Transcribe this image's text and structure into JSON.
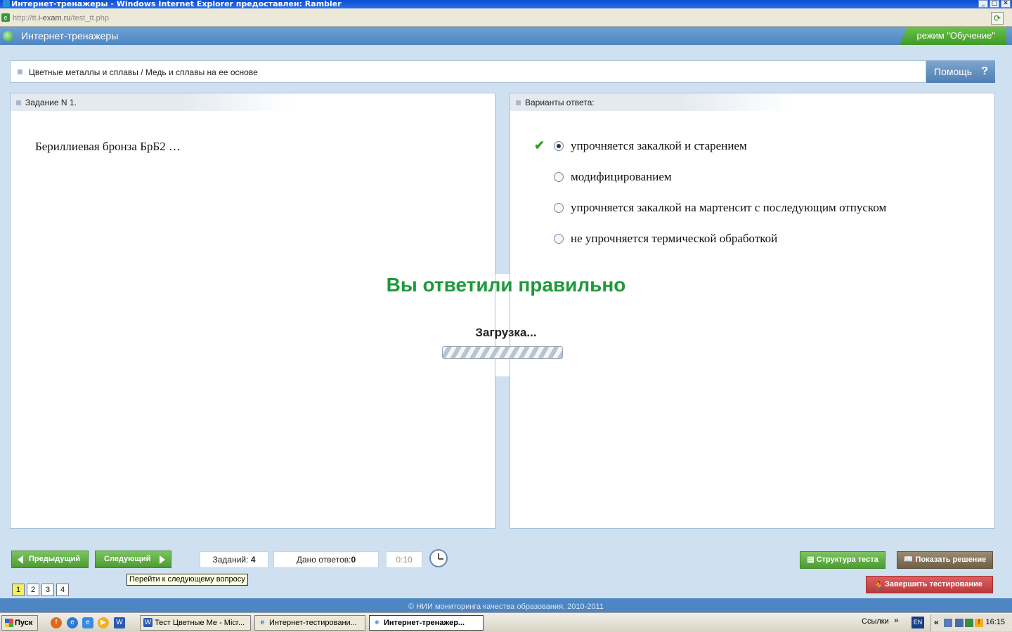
{
  "window": {
    "title": "Интернет-тренажеры - Windows Internet Explorer предоставлен: Rambler",
    "url_prefix": "http://tt.",
    "url_domain": "i-exam.ru",
    "url_path": "/test_tt.php"
  },
  "header": {
    "app_title": "Интернет-тренажеры",
    "mode": "режим \"Обучение\""
  },
  "breadcrumb": {
    "text": "Цветные металлы и сплавы / Медь и сплавы на ее основе",
    "help_label": "Помощь",
    "help_symbol": "?"
  },
  "task": {
    "header": "Задание N 1.",
    "question": "Бериллиевая бронза БрБ2 …"
  },
  "answers": {
    "header": "Варианты ответа:",
    "options": [
      {
        "label": "упрочняется закалкой и старением",
        "selected": true,
        "correct": true
      },
      {
        "label": "модифицированием",
        "selected": false
      },
      {
        "label": "упрочняется закалкой на мартенсит с последующим отпуском",
        "selected": false
      },
      {
        "label": "не упрочняется термической обработкой",
        "selected": false
      }
    ]
  },
  "overlay": {
    "result": "Вы ответили правильно",
    "loading": "Загрузка..."
  },
  "toolbar": {
    "prev_label": "Предыдущий",
    "next_label": "Следующий",
    "tasks_label": "Заданий:",
    "tasks_value": "4",
    "answers_label": "Дано ответов:",
    "answers_value": "0",
    "timer": "0:10",
    "tooltip": "Перейти к следующему вопросу",
    "structure_label": "Структура теста",
    "solution_label": "Показать решение",
    "finish_label": "Завершить тестирование",
    "pages": [
      "1",
      "2",
      "3",
      "4"
    ],
    "current_page": "1"
  },
  "footer": {
    "copyright": "© НИИ мониторинга качества образования, 2010-2011"
  },
  "taskbar": {
    "start_label": "Пуск",
    "tasks": [
      {
        "label": "Тест Цветные Ме - Micr...",
        "icon": "word-icon"
      },
      {
        "label": "Интернет-тестировани...",
        "icon": "ie-icon"
      },
      {
        "label": "Интернет-тренажер...",
        "icon": "ie-icon",
        "active": true
      }
    ],
    "links_label": "Ссылки",
    "links_chevron": "»",
    "tray_chevron": "«",
    "lang": "EN",
    "time": "16:15"
  },
  "colors": {
    "accent_green": "#1e9a3a",
    "header_blue": "#4d86c2",
    "mode_green": "#4c9c32",
    "finish_red": "#b83a3a"
  }
}
